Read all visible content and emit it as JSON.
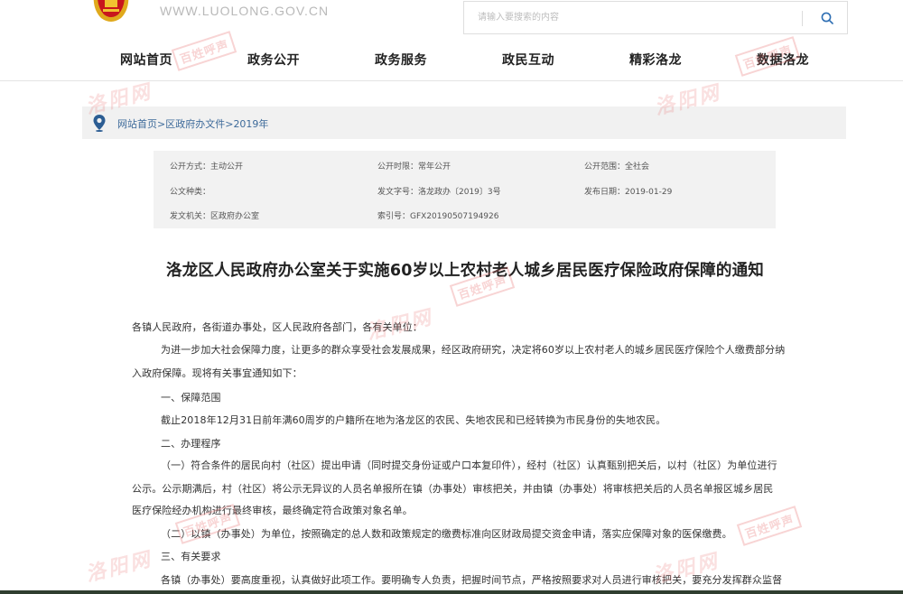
{
  "header": {
    "site_url": "WWW.LUOLONG.GOV.CN",
    "search_placeholder": "请输入要搜索的内容",
    "search_icon": "search-icon",
    "emblem_icon": "national-emblem-icon"
  },
  "nav": {
    "items": [
      "网站首页",
      "政务公开",
      "政务服务",
      "政民互动",
      "精彩洛龙",
      "数据洛龙"
    ]
  },
  "breadcrumb": {
    "icon": "location-pin-icon",
    "items": [
      "网站首页",
      "区政府办文件",
      "2019年"
    ],
    "separator": ">"
  },
  "meta": {
    "open_method": "公开方式：主动公开",
    "open_period": "公开时限：常年公开",
    "open_scope": "公开范围：全社会",
    "doc_type": "公文种类：",
    "doc_number": "发文字号：洛龙政办〔2019〕3号",
    "publish_date": "发布日期：2019-01-29",
    "issuer": "发文机关：区政府办公室",
    "index_number": "索引号：GFX20190507194926"
  },
  "article": {
    "title": "洛龙区人民政府办公室关于实施60岁以上农村老人城乡居民医疗保险政府保障的通知",
    "paragraphs": [
      "各镇人民政府，各街道办事处，区人民政府各部门，各有关单位：",
      "为进一步加大社会保障力度，让更多的群众享受社会发展成果，经区政府研究，决定将60岁以上农村老人的城乡居民医疗保险个人缴费部分纳",
      "入政府保障。现将有关事宜通知如下：",
      "一、保障范围",
      "截止2018年12月31日前年满60周岁的户籍所在地为洛龙区的农民、失地农民和已经转换为市民身份的失地农民。",
      "二、办理程序",
      "（一）符合条件的居民向村（社区）提出申请（同时提交身份证或户口本复印件），经村（社区）认真甄别把关后，以村（社区）为单位进行",
      "公示。公示期满后，村（社区）将公示无异议的人员名单报所在镇（办事处）审核把关，并由镇（办事处）将审核把关后的人员名单报区城乡居民",
      "医疗保险经办机构进行最终审核，最终确定符合政策对象名单。",
      "（二）以镇（办事处）为单位，按照确定的总人数和政策规定的缴费标准向区财政局提交资金申请，落实应保障对象的医保缴费。",
      "三、有关要求",
      "各镇（办事处）要高度重视，认真做好此项工作。要明确专人负责，把握时间节点，严格按照要求对人员进行审核把关，要充分发挥群众监督"
    ]
  },
  "watermarks": {
    "script_text": "洛阳网",
    "stamp_text": "百姓呼声"
  },
  "colors": {
    "link_blue": "#3d6a9a",
    "watermark_red": "#e77070",
    "emblem_red": "#c8161d",
    "emblem_gold": "#f2c230"
  }
}
